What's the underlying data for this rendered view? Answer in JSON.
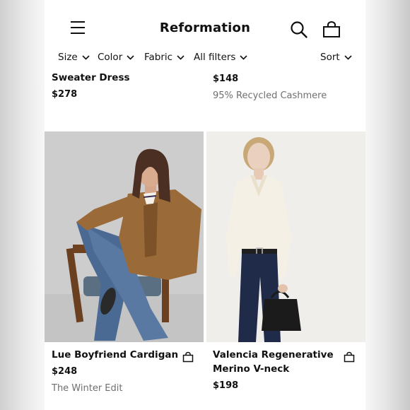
{
  "header": {
    "brand": "Reformation"
  },
  "filters": {
    "size": "Size",
    "color": "Color",
    "fabric": "Fabric",
    "all_filters": "All filters",
    "sort": "Sort"
  },
  "top_products": [
    {
      "name": "Sweater Dress",
      "price": "$278"
    },
    {
      "price": "$148",
      "tag": "95% Recycled Cashmere"
    }
  ],
  "products": [
    {
      "name": "Lue Boyfriend Cardigan",
      "price": "$248",
      "tag": "The Winter Edit"
    },
    {
      "name_line1": "Valencia Regenerative",
      "name_line2": "Merino V-neck",
      "price": "$198"
    }
  ]
}
